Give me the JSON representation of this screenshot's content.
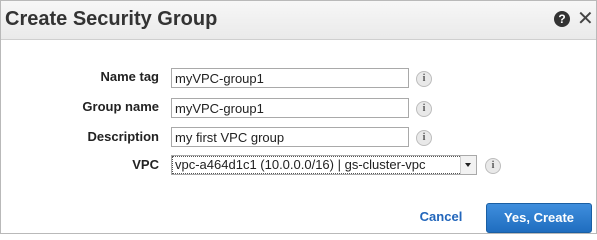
{
  "dialog": {
    "title": "Create Security Group",
    "help_icon": "question-circle-icon",
    "close_icon": "close-icon",
    "close_glyph": "✕"
  },
  "form": {
    "name_tag": {
      "label": "Name tag",
      "value": "myVPC-group1"
    },
    "group_name": {
      "label": "Group name",
      "value": "myVPC-group1"
    },
    "description": {
      "label": "Description",
      "value": "my first VPC group"
    },
    "vpc": {
      "label": "VPC",
      "selected": "vpc-a464d1c1 (10.0.0.0/16) | gs-cluster-vpc"
    },
    "info_glyph": "i"
  },
  "footer": {
    "cancel_label": "Cancel",
    "create_label": "Yes, Create"
  },
  "colors": {
    "primary_button": "#2a7ed3",
    "link": "#2266bb"
  }
}
